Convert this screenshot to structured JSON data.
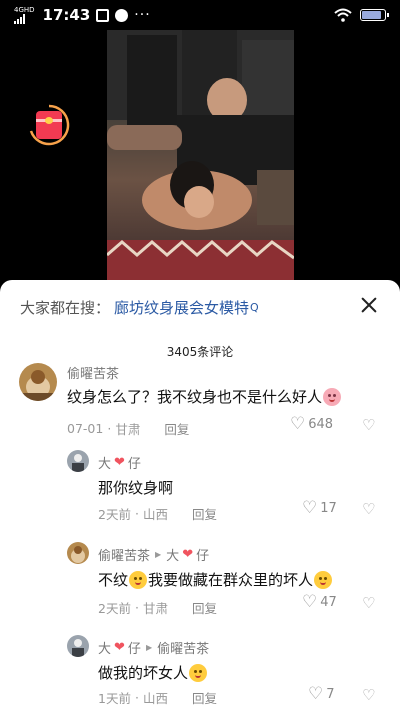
{
  "status_bar": {
    "network": "4GHD",
    "time": "17:43",
    "more": "···"
  },
  "search": {
    "prefix": "大家都在搜：",
    "query": "廊坊纹身展会女模特",
    "query_icon": "Q"
  },
  "comments_count_title": "3405条评论",
  "comments": [
    {
      "author": "偷曜苦茶",
      "text": "纹身怎么了？我不纹身也不是什么好人",
      "date": "07-01",
      "location": "甘肃",
      "reply_label": "回复",
      "likes": "648",
      "emoji": "pig-face"
    }
  ],
  "replies": [
    {
      "author_prefix": "大",
      "author_suffix": "仔",
      "text": "那你纹身啊",
      "date": "2天前",
      "location": "山西",
      "reply_label": "回复",
      "likes": "17"
    },
    {
      "author": "偷曜苦茶",
      "reply_to_prefix": "大",
      "reply_to_suffix": "仔",
      "text_a": "不纹",
      "text_b": "我要做藏在群众里的坏人",
      "date": "2天前",
      "location": "甘肃",
      "reply_label": "回复",
      "likes": "47"
    },
    {
      "author_prefix": "大",
      "author_suffix": "仔",
      "reply_to": "偷曜苦茶",
      "text": "做我的坏女人",
      "date": "1天前",
      "location": "山西",
      "reply_label": "回复",
      "likes": "7"
    }
  ],
  "colors": {
    "link": "#2b5aa4",
    "heart_red": "#f0545f",
    "redpacket": "#f23a52"
  }
}
